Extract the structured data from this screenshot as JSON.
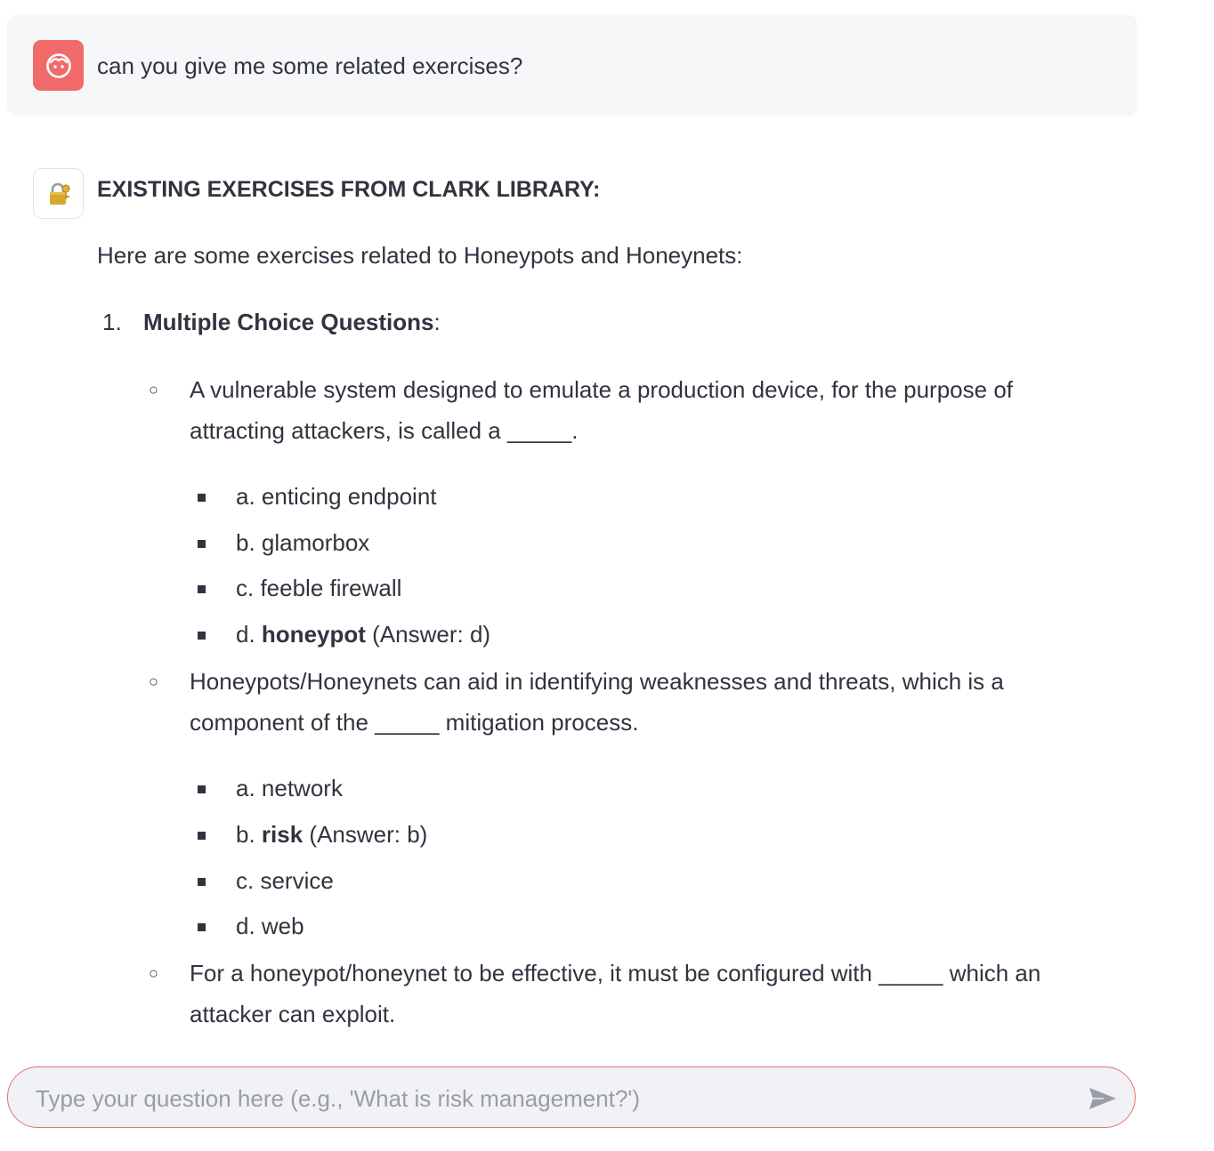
{
  "colors": {
    "user_avatar_bg": "#f06a6a",
    "user_message_bg": "#f6f7f9",
    "input_border": "#ef6c6c",
    "input_bg": "#f0f2f6",
    "text": "#31333f"
  },
  "user_message": {
    "avatar_icon": "face-icon",
    "text": "can you give me some related exercises?"
  },
  "assistant_message": {
    "avatar_icon": "lock-with-key-icon",
    "heading": "EXISTING EXERCISES FROM CLARK LIBRARY:",
    "intro": "Here are some exercises related to Honeypots and Honeynets:",
    "section": {
      "number": "1.",
      "title": "Multiple Choice Questions",
      "title_suffix": ":"
    },
    "questions": [
      {
        "text": "A vulnerable system designed to emulate a production device, for the purpose of attracting attackers, is called a _____.",
        "options": [
          {
            "prefix": "a. enticing endpoint",
            "bold": "",
            "suffix": ""
          },
          {
            "prefix": "b. glamorbox",
            "bold": "",
            "suffix": ""
          },
          {
            "prefix": "c. feeble firewall",
            "bold": "",
            "suffix": ""
          },
          {
            "prefix": "d. ",
            "bold": "honeypot",
            "suffix": " (Answer: d)"
          }
        ]
      },
      {
        "text": "Honeypots/Honeynets can aid in identifying weaknesses and threats, which is a component of the _____ mitigation process.",
        "options": [
          {
            "prefix": "a. network",
            "bold": "",
            "suffix": ""
          },
          {
            "prefix": "b. ",
            "bold": "risk",
            "suffix": " (Answer: b)"
          },
          {
            "prefix": "c. service",
            "bold": "",
            "suffix": ""
          },
          {
            "prefix": "d. web",
            "bold": "",
            "suffix": ""
          }
        ]
      },
      {
        "text": "For a honeypot/honeynet to be effective, it must be configured with _____ which an attacker can exploit.",
        "options": []
      }
    ]
  },
  "chat_input": {
    "placeholder": "Type your question here (e.g., 'What is risk management?')",
    "value": "",
    "send_icon": "send-icon"
  }
}
